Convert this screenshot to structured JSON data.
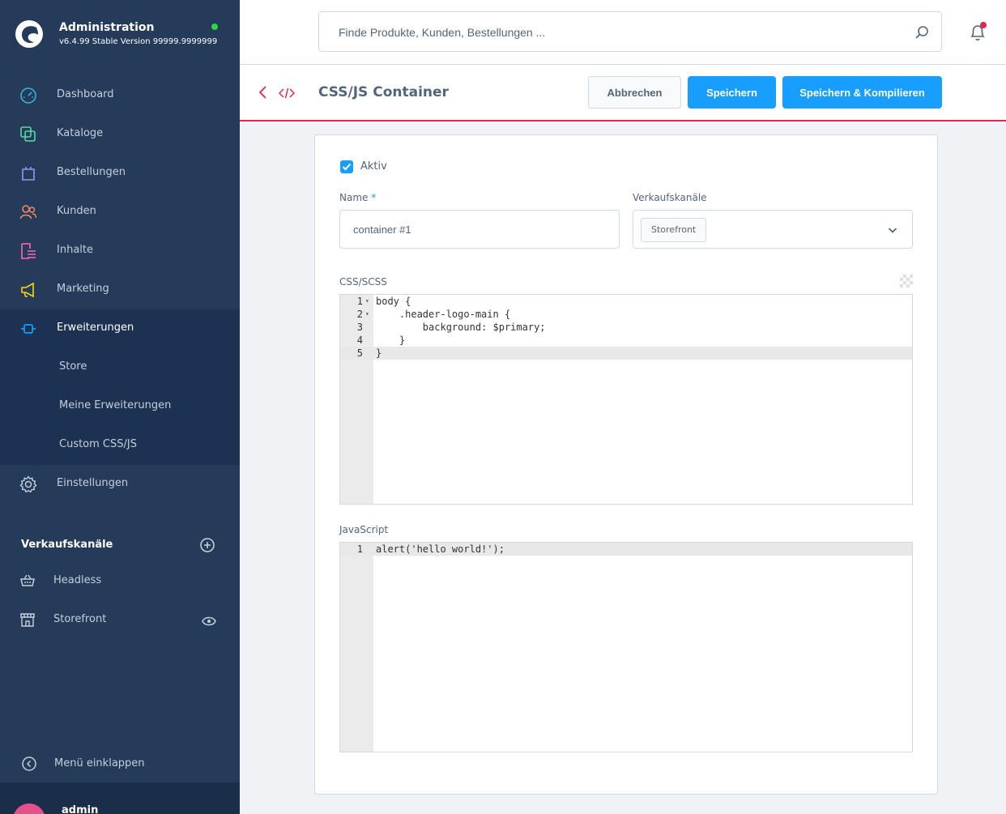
{
  "app": {
    "title": "Administration",
    "version": "v6.4.99 Stable Version 99999.9999999"
  },
  "sidebar": {
    "items": [
      {
        "label": "Dashboard",
        "icon": "gauge-icon",
        "color": "#40b0d8"
      },
      {
        "label": "Kataloge",
        "icon": "catalog-icon",
        "color": "#57d9a3"
      },
      {
        "label": "Bestellungen",
        "icon": "shopping-bag-icon",
        "color": "#a092f0"
      },
      {
        "label": "Kunden",
        "icon": "users-icon",
        "color": "#f88962"
      },
      {
        "label": "Inhalte",
        "icon": "content-icon",
        "color": "#ff68b4"
      },
      {
        "label": "Marketing",
        "icon": "megaphone-icon",
        "color": "#ffd700"
      },
      {
        "label": "Erweiterungen",
        "icon": "plugin-icon",
        "color": "#189eff"
      },
      {
        "label": "Einstellungen",
        "icon": "gear-icon",
        "color": "#c5cfdb"
      }
    ],
    "extensions_sub": [
      "Store",
      "Meine Erweiterungen",
      "Custom CSS/JS"
    ],
    "sales_channels_heading": "Verkaufskanäle",
    "sales_channels": [
      {
        "label": "Headless",
        "icon": "basket-icon"
      },
      {
        "label": "Storefront",
        "icon": "storefront-icon"
      }
    ],
    "collapse_label": "Menü einklappen",
    "user_name": "admin"
  },
  "search": {
    "placeholder": "Finde Produkte, Kunden, Bestellungen ..."
  },
  "page": {
    "title": "CSS/JS Container",
    "cancel_label": "Abbrechen",
    "save_label": "Speichern",
    "save_compile_label": "Speichern & Kompilieren"
  },
  "form": {
    "active_label": "Aktiv",
    "active_checked": true,
    "name_label": "Name",
    "name_required_mark": "*",
    "name_value": "container #1",
    "sales_channels_label": "Verkaufskanäle",
    "sales_channel_selected": "Storefront",
    "css_label": "CSS/SCSS",
    "js_label": "JavaScript"
  },
  "css_code": [
    {
      "num": "1",
      "fold": true,
      "text": "body {"
    },
    {
      "num": "2",
      "fold": true,
      "text": "    .header-logo-main {"
    },
    {
      "num": "3",
      "fold": false,
      "text": "        background: $primary;"
    },
    {
      "num": "4",
      "fold": false,
      "text": "    }"
    },
    {
      "num": "5",
      "fold": false,
      "text": "}"
    }
  ],
  "js_code": [
    {
      "num": "1",
      "fold": false,
      "text": "alert('hello world!');"
    }
  ],
  "colors": {
    "accent": "#189eff",
    "danger": "#de294c",
    "sidebar_bg": "#243b5a",
    "online": "#37d046"
  }
}
